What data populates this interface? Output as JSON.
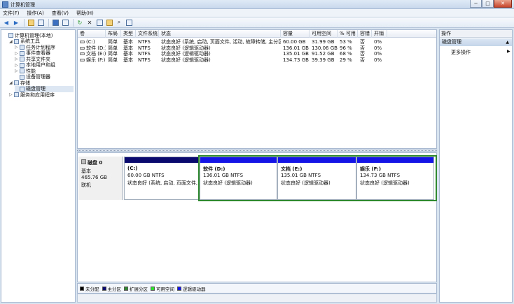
{
  "window": {
    "title": "计算机管理"
  },
  "window_buttons": [
    "─",
    "□",
    "✕"
  ],
  "menu": [
    "文件(F)",
    "操作(A)",
    "查看(V)",
    "帮助(H)"
  ],
  "tree": [
    {
      "label": "计算机管理(本地)",
      "level": 0,
      "exp": "",
      "icon": "computer-icon"
    },
    {
      "label": "系统工具",
      "level": 1,
      "exp": "◢",
      "icon": "tools-icon"
    },
    {
      "label": "任务计划程序",
      "level": 2,
      "exp": "▷",
      "icon": "clock-icon"
    },
    {
      "label": "事件查看器",
      "level": 2,
      "exp": "▷",
      "icon": "event-icon"
    },
    {
      "label": "共享文件夹",
      "level": 2,
      "exp": "▷",
      "icon": "folder-icon"
    },
    {
      "label": "本地用户和组",
      "level": 2,
      "exp": "▷",
      "icon": "users-icon"
    },
    {
      "label": "性能",
      "level": 2,
      "exp": "▷",
      "icon": "performance-icon"
    },
    {
      "label": "设备管理器",
      "level": 2,
      "exp": "",
      "icon": "device-icon"
    },
    {
      "label": "存储",
      "level": 1,
      "exp": "◢",
      "icon": "storage-icon"
    },
    {
      "label": "磁盘管理",
      "level": 2,
      "exp": "",
      "icon": "disk-icon",
      "selected": true
    },
    {
      "label": "服务和应用程序",
      "level": 1,
      "exp": "▷",
      "icon": "services-icon"
    }
  ],
  "volume_table": {
    "headers": [
      "卷",
      "布局",
      "类型",
      "文件系统",
      "状态",
      "容量",
      "可用空间",
      "% 可用",
      "容错",
      "开销"
    ],
    "rows": [
      [
        "(C:)",
        "简单",
        "基本",
        "NTFS",
        "状态良好 (系统, 启动, 页面文件, 活动, 故障转储, 主分区)",
        "60.00 GB",
        "31.99 GB",
        "53 %",
        "否",
        "0%"
      ],
      [
        "软件 (D:)",
        "简单",
        "基本",
        "NTFS",
        "状态良好 (逻辑驱动器)",
        "136.01 GB",
        "130.06 GB",
        "96 %",
        "否",
        "0%"
      ],
      [
        "文档 (E:)",
        "简单",
        "基本",
        "NTFS",
        "状态良好 (逻辑驱动器)",
        "135.01 GB",
        "91.52 GB",
        "68 %",
        "否",
        "0%"
      ],
      [
        "娱乐 (F:)",
        "简单",
        "基本",
        "NTFS",
        "状态良好 (逻辑驱动器)",
        "134.73 GB",
        "39.39 GB",
        "29 %",
        "否",
        "0%"
      ]
    ]
  },
  "disk": {
    "name": "磁盘 0",
    "type": "基本",
    "size": "465.76 GB",
    "status": "联机",
    "partitions": [
      {
        "name": "(C:)",
        "size": "60.00 GB NTFS",
        "status": "状态良好 (系统, 启动, 页面文件,",
        "bar_color": "#0a0a6e"
      },
      {
        "name": "软件  (D:)",
        "size": "136.01 GB NTFS",
        "status": "状态良好 (逻辑驱动器)",
        "bar_color": "#1414e6"
      },
      {
        "name": "文档  (E:)",
        "size": "135.01 GB NTFS",
        "status": "状态良好 (逻辑驱动器)",
        "bar_color": "#1414e6"
      },
      {
        "name": "娱乐  (F:)",
        "size": "134.73 GB NTFS",
        "status": "状态良好 (逻辑驱动器)",
        "bar_color": "#1414e6"
      }
    ]
  },
  "legend": [
    {
      "label": "未分配",
      "color": "#000000"
    },
    {
      "label": "主分区",
      "color": "#0a0a6e"
    },
    {
      "label": "扩展分区",
      "color": "#2f8a2f"
    },
    {
      "label": "可用空间",
      "color": "#2ee02e"
    },
    {
      "label": "逻辑驱动器",
      "color": "#1414e6"
    }
  ],
  "actions": {
    "header": "操作",
    "section": "磁盘管理",
    "section_arrow": "▲",
    "more": "更多操作",
    "more_arrow": "▶"
  }
}
